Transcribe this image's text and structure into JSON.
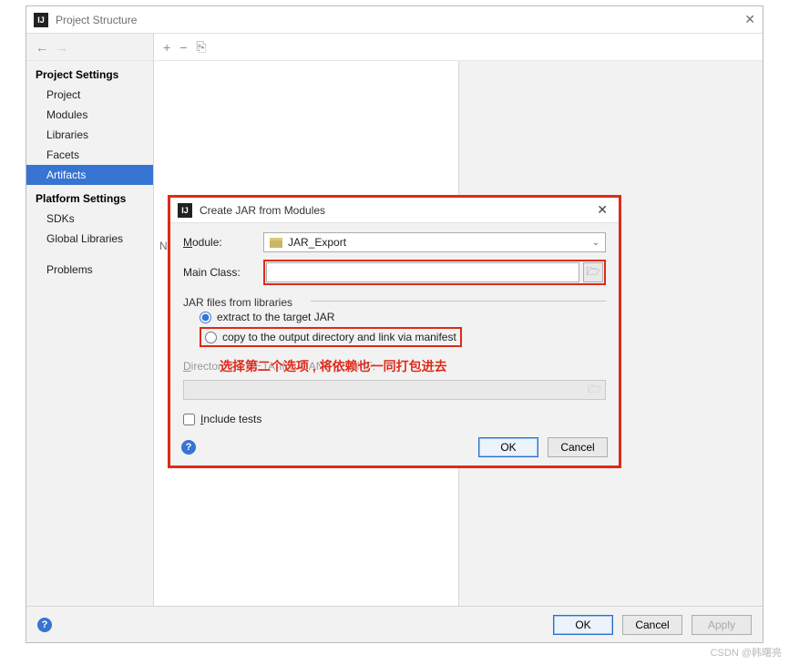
{
  "window": {
    "title": "Project Structure"
  },
  "nav": {
    "back_icon": "←",
    "forward_icon": "→"
  },
  "sidebar": {
    "section1_title": "Project Settings",
    "items1": [
      {
        "label": "Project"
      },
      {
        "label": "Modules"
      },
      {
        "label": "Libraries"
      },
      {
        "label": "Facets"
      },
      {
        "label": "Artifacts"
      }
    ],
    "section2_title": "Platform Settings",
    "items2": [
      {
        "label": "SDKs"
      },
      {
        "label": "Global Libraries"
      }
    ],
    "items3": [
      {
        "label": "Problems"
      }
    ]
  },
  "toolbar": {
    "add_icon": "+",
    "remove_icon": "−",
    "copy_icon": "⎘"
  },
  "tree": {
    "letter": "N"
  },
  "dialog": {
    "title": "Create JAR from Modules",
    "module_label": "Module:",
    "module_letter": "M",
    "module_value": "JAR_Export",
    "mainclass_label": "Main Class:",
    "mainclass_value": "",
    "fieldset_label": "JAR files from libraries",
    "radio_extract": "extract to the target JAR",
    "radio_copy": "copy to the output directory and link via manifest",
    "dir_label": "Directory for META-INF/MANIFEST.MF:",
    "include_tests": "Include tests",
    "ok": "OK",
    "cancel": "Cancel"
  },
  "annotation": {
    "text": "选择第二个选项 , 将依赖也一同打包进去"
  },
  "footer": {
    "ok": "OK",
    "cancel": "Cancel",
    "apply": "Apply"
  },
  "watermark": "CSDN @韩曙亮"
}
